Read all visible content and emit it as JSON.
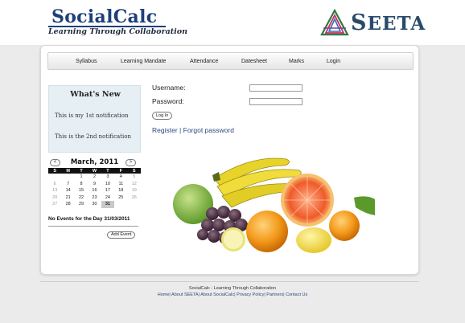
{
  "brand": {
    "name": "SocialCalc",
    "tagline": "Learning Through Collaboration",
    "partner_first": "S",
    "partner_rest": "EETA"
  },
  "nav": {
    "items": [
      "Syllabus",
      "Learning Mandate",
      "Attendance",
      "Datesheet",
      "Marks",
      "Login"
    ]
  },
  "whats_new": {
    "title": "What's New",
    "notifications": [
      "This is my 1st notification",
      "This is the 2nd notification"
    ]
  },
  "calendar": {
    "month": "March, 2011",
    "prev": "<",
    "next": ">",
    "weekdays": [
      "S",
      "M",
      "T",
      "W",
      "T",
      "F",
      "S"
    ],
    "weeks": [
      [
        "",
        "",
        "1",
        "2",
        "3",
        "4",
        "5"
      ],
      [
        "6",
        "7",
        "8",
        "9",
        "10",
        "11",
        "12"
      ],
      [
        "13",
        "14",
        "15",
        "16",
        "17",
        "18",
        "19"
      ],
      [
        "20",
        "21",
        "22",
        "23",
        "24",
        "25",
        "26"
      ],
      [
        "27",
        "28",
        "29",
        "30",
        "31",
        "",
        ""
      ]
    ],
    "selected_day": "31",
    "events_text": "No Events for the Day 31/03/2011",
    "add_event_label": "Add Event"
  },
  "login": {
    "username_label": "Username:",
    "password_label": "Password:",
    "username_value": "",
    "password_value": "",
    "login_button": "Log In",
    "register_link": "Register",
    "separator": "|",
    "forgot_link": "Forgot password"
  },
  "footer": {
    "title": "SocialCalc - Learning Through Collaboration",
    "links": [
      "Home",
      "About SEETA",
      "About SocialCalc",
      "Privacy Policy",
      "Partners",
      "Contact Us"
    ]
  },
  "colors": {
    "brand_blue": "#1d3f7a",
    "link_blue": "#2a4a7f",
    "sidebar_bg": "#e6eff3",
    "page_bg": "#ebebeb"
  }
}
